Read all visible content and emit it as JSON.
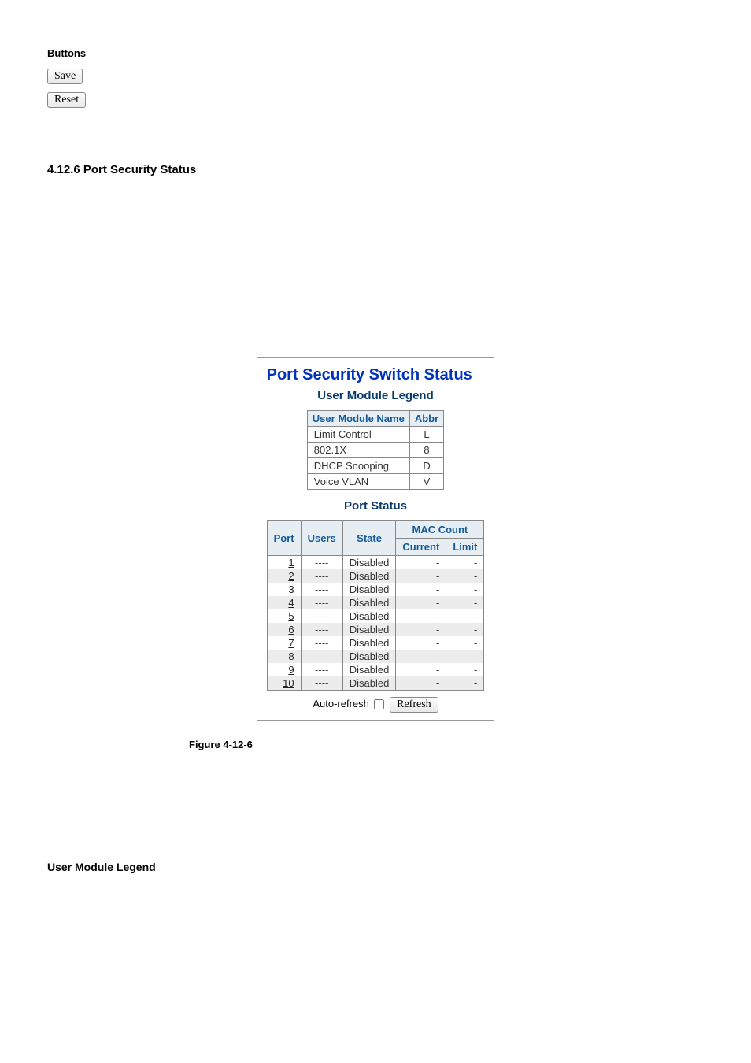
{
  "top": {
    "buttons_label": "Buttons",
    "save_label": "Save",
    "reset_label": "Reset"
  },
  "section_heading": "4.12.6 Port Security Status",
  "panel": {
    "title": "Port Security Switch Status",
    "legend_heading": "User Module Legend",
    "legend": {
      "headers": {
        "name": "User Module Name",
        "abbr": "Abbr"
      },
      "rows": [
        {
          "name": "Limit Control",
          "abbr": "L"
        },
        {
          "name": "802.1X",
          "abbr": "8"
        },
        {
          "name": "DHCP Snooping",
          "abbr": "D"
        },
        {
          "name": "Voice VLAN",
          "abbr": "V"
        }
      ]
    },
    "port_status_heading": "Port Status",
    "ports": {
      "headers": {
        "port": "Port",
        "users": "Users",
        "state": "State",
        "mac_count": "MAC Count",
        "current": "Current",
        "limit": "Limit"
      },
      "rows": [
        {
          "port": "1",
          "users": "----",
          "state": "Disabled",
          "current": "-",
          "limit": "-"
        },
        {
          "port": "2",
          "users": "----",
          "state": "Disabled",
          "current": "-",
          "limit": "-"
        },
        {
          "port": "3",
          "users": "----",
          "state": "Disabled",
          "current": "-",
          "limit": "-"
        },
        {
          "port": "4",
          "users": "----",
          "state": "Disabled",
          "current": "-",
          "limit": "-"
        },
        {
          "port": "5",
          "users": "----",
          "state": "Disabled",
          "current": "-",
          "limit": "-"
        },
        {
          "port": "6",
          "users": "----",
          "state": "Disabled",
          "current": "-",
          "limit": "-"
        },
        {
          "port": "7",
          "users": "----",
          "state": "Disabled",
          "current": "-",
          "limit": "-"
        },
        {
          "port": "8",
          "users": "----",
          "state": "Disabled",
          "current": "-",
          "limit": "-"
        },
        {
          "port": "9",
          "users": "----",
          "state": "Disabled",
          "current": "-",
          "limit": "-"
        },
        {
          "port": "10",
          "users": "----",
          "state": "Disabled",
          "current": "-",
          "limit": "-"
        }
      ]
    },
    "footer": {
      "auto_refresh_label": "Auto-refresh",
      "refresh_label": "Refresh"
    }
  },
  "figure_caption": "Figure 4-12-6",
  "bottom_heading": "User Module Legend"
}
